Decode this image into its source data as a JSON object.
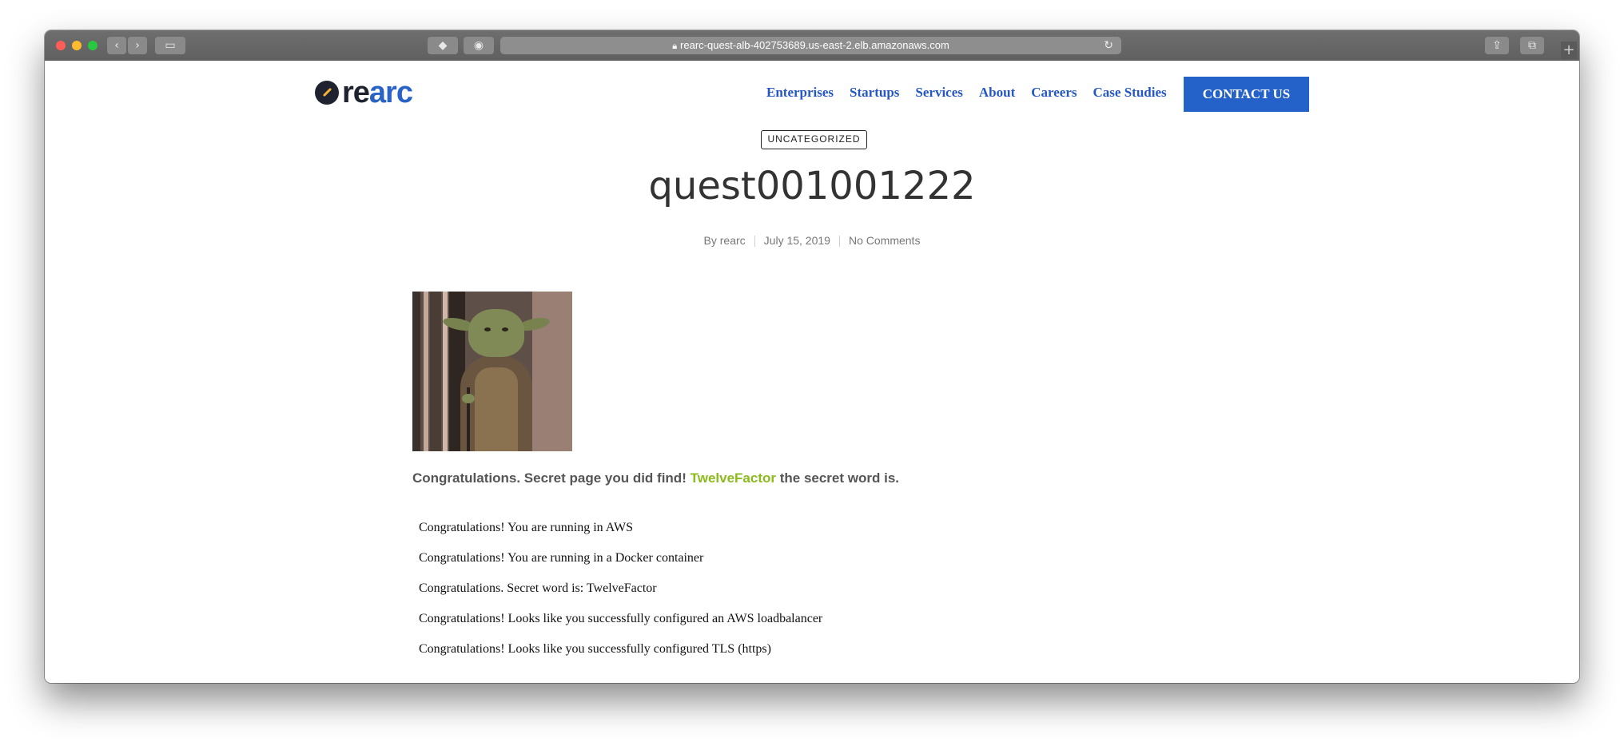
{
  "browser": {
    "url": "rearc-quest-alb-402753689.us-east-2.elb.amazonaws.com"
  },
  "site": {
    "logo_prefix": "re",
    "logo_suffix": "arc",
    "nav": [
      "Enterprises",
      "Startups",
      "Services",
      "About",
      "Careers",
      "Case Studies"
    ],
    "contact_label": "CONTACT US"
  },
  "post": {
    "category": "UNCATEGORIZED",
    "title": "quest001001222",
    "author": "By rearc",
    "date": "July 15, 2019",
    "comments": "No Comments"
  },
  "content": {
    "secret_prefix": "Congratulations. Secret page you did find!",
    "secret_word": "TwelveFactor",
    "secret_suffix": "the secret word is.",
    "checks": [
      "Congratulations! You are running in AWS",
      "Congratulations! You are running in a Docker container",
      "Congratulations. Secret word is: TwelveFactor",
      "Congratulations! Looks like you successfully configured an AWS loadbalancer",
      "Congratulations! Looks like you successfully configured TLS (https)"
    ]
  },
  "colors": {
    "brand_blue": "#2461c9",
    "secret_green": "#8bbb1c"
  }
}
